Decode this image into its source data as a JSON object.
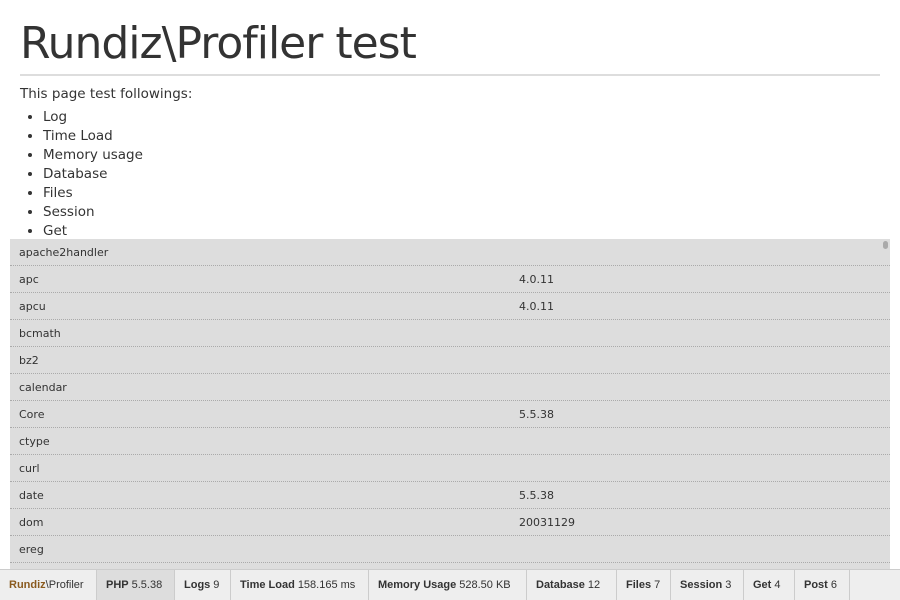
{
  "title": "Rundiz\\Profiler test",
  "intro": "This page test followings:",
  "list": [
    "Log",
    "Time Load",
    "Memory usage",
    "Database",
    "Files",
    "Session",
    "Get"
  ],
  "rows": [
    {
      "name": "apache2handler",
      "value": ""
    },
    {
      "name": "apc",
      "value": "4.0.11"
    },
    {
      "name": "apcu",
      "value": "4.0.11"
    },
    {
      "name": "bcmath",
      "value": ""
    },
    {
      "name": "bz2",
      "value": ""
    },
    {
      "name": "calendar",
      "value": ""
    },
    {
      "name": "Core",
      "value": "5.5.38"
    },
    {
      "name": "ctype",
      "value": ""
    },
    {
      "name": "curl",
      "value": ""
    },
    {
      "name": "date",
      "value": "5.5.38"
    },
    {
      "name": "dom",
      "value": "20031129"
    },
    {
      "name": "ereg",
      "value": ""
    }
  ],
  "toolbar": {
    "logo_brand": "Rundiz",
    "logo_rest": "\\Profiler",
    "tabs": [
      {
        "label": "PHP",
        "value": "5.5.38"
      },
      {
        "label": "Logs",
        "value": "9"
      },
      {
        "label": "Time Load",
        "value": "158.165 ms"
      },
      {
        "label": "Memory Usage",
        "value": "528.50 KB"
      },
      {
        "label": "Database",
        "value": "12"
      },
      {
        "label": "Files",
        "value": "7"
      },
      {
        "label": "Session",
        "value": "3"
      },
      {
        "label": "Get",
        "value": "4"
      },
      {
        "label": "Post",
        "value": "6"
      }
    ]
  },
  "colors": {
    "brand": "#8a5a1e",
    "panel": "#dddddd"
  }
}
